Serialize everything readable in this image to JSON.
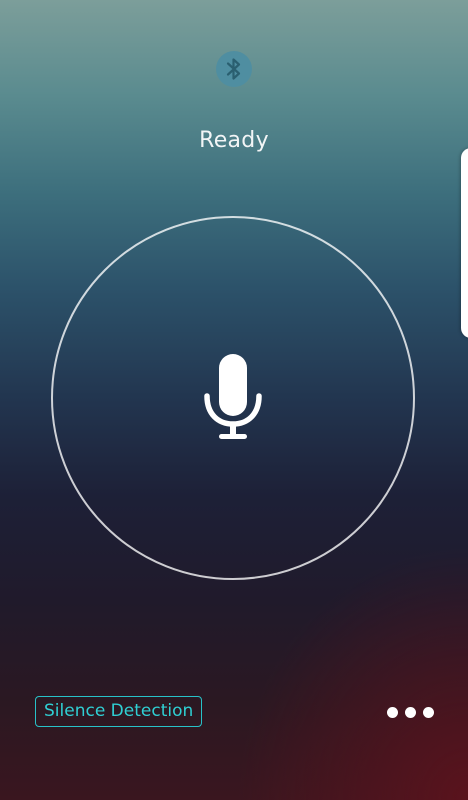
{
  "status": {
    "label": "Ready"
  },
  "bluetooth": {
    "icon": "bluetooth-icon",
    "color": "#4f8ea1"
  },
  "record": {
    "icon": "microphone-icon"
  },
  "footer": {
    "silence_detection_label": "Silence Detection",
    "more_icon": "more-horizontal-icon"
  },
  "colors": {
    "accent": "#2fcfd3",
    "circle_stroke": "#ffffff",
    "text": "#f2f5f6"
  }
}
